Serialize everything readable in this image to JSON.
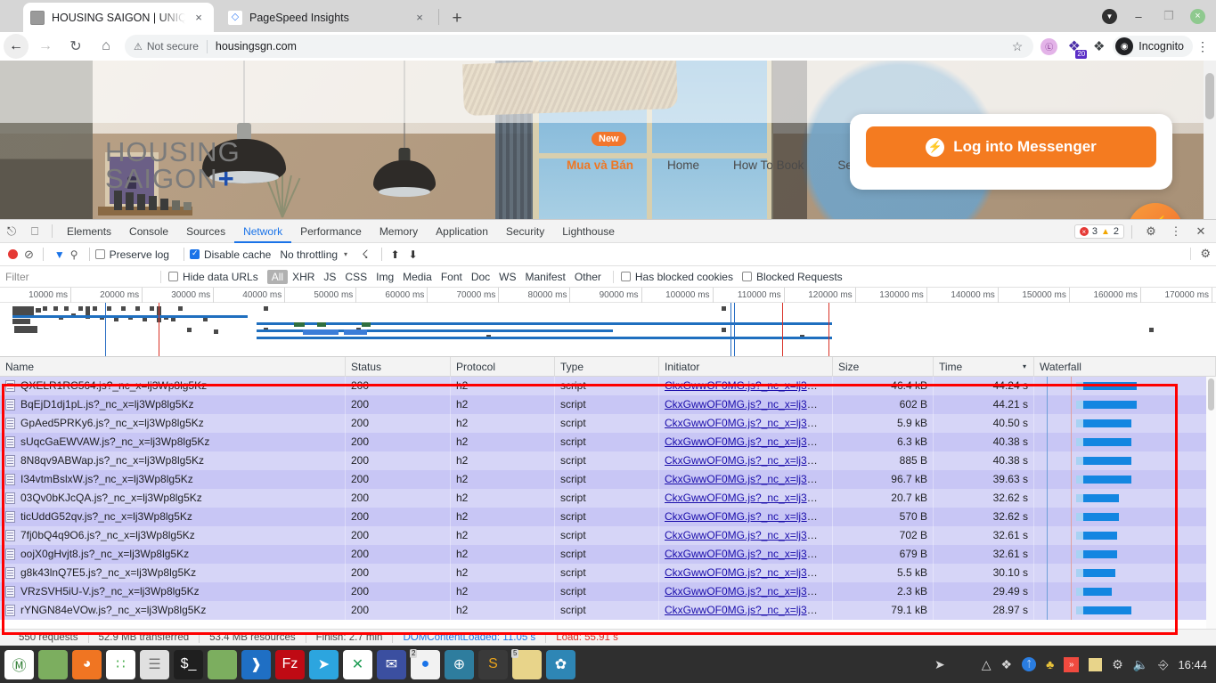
{
  "browser": {
    "tabs": [
      {
        "title": "HOUSING SAIGON | UNIQUE A",
        "favicon": "site-thumbnail-icon",
        "active": true,
        "close_label": "×"
      },
      {
        "title": "PageSpeed Insights",
        "favicon": "pagespeed-icon",
        "active": false,
        "close_label": "×"
      }
    ],
    "new_tab_label": "+",
    "window_controls": {
      "restore": "▼",
      "minimize": "–",
      "maximize": "❐",
      "close": "×"
    },
    "nav": {
      "back": "←",
      "forward": "→",
      "reload": "↻",
      "home": "⌂"
    },
    "omnibox": {
      "security_label": "Not secure",
      "security_icon": "warning-triangle-icon",
      "url": "housingsgn.com",
      "bookmark_star": "☆"
    },
    "extensions": [
      {
        "name": "lastpass-extension-icon",
        "glyph": "Ⓛ"
      },
      {
        "name": "bookmark-manager-extension-icon",
        "glyph": "❖",
        "badge": "20"
      },
      {
        "name": "extensions-puzzle-icon",
        "glyph": "❖"
      }
    ],
    "profile": {
      "label": "Incognito",
      "icon": "incognito-hat-icon"
    },
    "menu_label": "⋮"
  },
  "webpage": {
    "logo_line1": "HOUSING",
    "logo_line2": "SAIGON",
    "logo_plus": "+",
    "new_badge": "New",
    "nav_items": [
      "Mua và Bán",
      "Home",
      "How To Book",
      "Search b"
    ],
    "messenger_card": {
      "button_label": "Log into Messenger",
      "button_icon": "messenger-glyph-icon",
      "color": "#f47b20"
    },
    "fab_icon": "messenger-fab-icon"
  },
  "devtools": {
    "tabs": [
      "Elements",
      "Console",
      "Sources",
      "Network",
      "Performance",
      "Memory",
      "Application",
      "Security",
      "Lighthouse"
    ],
    "active_tab": "Network",
    "inspect_icon": "inspect-element-icon",
    "device_icon": "toggle-device-toolbar-icon",
    "issues": {
      "errors": "3",
      "warnings": "2"
    },
    "settings_icon": "gear-icon",
    "more_icon": "kebab-menu-icon",
    "close_icon": "close-icon",
    "toolbar": {
      "record_icon": "record-stop-icon",
      "clear_icon": "clear-network-log-icon",
      "filter_icon": "filter-funnel-icon",
      "search_icon": "search-icon",
      "preserve_log_label": "Preserve log",
      "preserve_log_checked": false,
      "disable_cache_label": "Disable cache",
      "disable_cache_checked": true,
      "throttling_value": "No throttling",
      "throttling_caret": "▾",
      "network_conditions_icon": "wifi-settings-icon",
      "import_icon": "import-har-icon",
      "export_icon": "export-har-icon",
      "settings_icon": "gear-icon"
    },
    "filterbar": {
      "filter_placeholder": "Filter",
      "filter_value": "",
      "hide_data_urls_label": "Hide data URLs",
      "hide_data_urls_checked": false,
      "types": [
        "All",
        "XHR",
        "JS",
        "CSS",
        "Img",
        "Media",
        "Font",
        "Doc",
        "WS",
        "Manifest",
        "Other"
      ],
      "selected_type": "All",
      "has_blocked_cookies_label": "Has blocked cookies",
      "has_blocked_cookies_checked": false,
      "blocked_requests_label": "Blocked Requests",
      "blocked_requests_checked": false
    },
    "overview_ticks": [
      "10000 ms",
      "20000 ms",
      "30000 ms",
      "40000 ms",
      "50000 ms",
      "60000 ms",
      "70000 ms",
      "80000 ms",
      "90000 ms",
      "100000 ms",
      "110000 ms",
      "120000 ms",
      "130000 ms",
      "140000 ms",
      "150000 ms",
      "160000 ms",
      "170000 ms"
    ],
    "columns": [
      "Name",
      "Status",
      "Protocol",
      "Type",
      "Initiator",
      "Size",
      "Time",
      "Waterfall"
    ],
    "sorted_column": "Time",
    "sort_caret": "▾",
    "rows": [
      {
        "name": "QXELR1RC564.js?_nc_x=lj3Wp8lg5Kz",
        "status": "200",
        "protocol": "h2",
        "type": "script",
        "initiator": "CkxGwwOF0MG.js?_nc_x=lj3Wp...",
        "size": "46.4 kB",
        "time": "44.24 s"
      },
      {
        "name": "BqEjD1dj1pL.js?_nc_x=lj3Wp8lg5Kz",
        "status": "200",
        "protocol": "h2",
        "type": "script",
        "initiator": "CkxGwwOF0MG.js?_nc_x=lj3Wp...",
        "size": "602 B",
        "time": "44.21 s"
      },
      {
        "name": "GpAed5PRKy6.js?_nc_x=lj3Wp8lg5Kz",
        "status": "200",
        "protocol": "h2",
        "type": "script",
        "initiator": "CkxGwwOF0MG.js?_nc_x=lj3Wp...",
        "size": "5.9 kB",
        "time": "40.50 s"
      },
      {
        "name": "sUqcGaEWVAW.js?_nc_x=lj3Wp8lg5Kz",
        "status": "200",
        "protocol": "h2",
        "type": "script",
        "initiator": "CkxGwwOF0MG.js?_nc_x=lj3Wp...",
        "size": "6.3 kB",
        "time": "40.38 s"
      },
      {
        "name": "8N8qv9ABWap.js?_nc_x=lj3Wp8lg5Kz",
        "status": "200",
        "protocol": "h2",
        "type": "script",
        "initiator": "CkxGwwOF0MG.js?_nc_x=lj3Wp...",
        "size": "885 B",
        "time": "40.38 s"
      },
      {
        "name": "I34vtmBslxW.js?_nc_x=lj3Wp8lg5Kz",
        "status": "200",
        "protocol": "h2",
        "type": "script",
        "initiator": "CkxGwwOF0MG.js?_nc_x=lj3Wp...",
        "size": "96.7 kB",
        "time": "39.63 s"
      },
      {
        "name": "03Qv0bKJcQA.js?_nc_x=lj3Wp8lg5Kz",
        "status": "200",
        "protocol": "h2",
        "type": "script",
        "initiator": "CkxGwwOF0MG.js?_nc_x=lj3Wp...",
        "size": "20.7 kB",
        "time": "32.62 s"
      },
      {
        "name": "ticUddG52qv.js?_nc_x=lj3Wp8lg5Kz",
        "status": "200",
        "protocol": "h2",
        "type": "script",
        "initiator": "CkxGwwOF0MG.js?_nc_x=lj3Wp...",
        "size": "570 B",
        "time": "32.62 s"
      },
      {
        "name": "7fj0bQ4q9O6.js?_nc_x=lj3Wp8lg5Kz",
        "status": "200",
        "protocol": "h2",
        "type": "script",
        "initiator": "CkxGwwOF0MG.js?_nc_x=lj3Wp...",
        "size": "702 B",
        "time": "32.61 s"
      },
      {
        "name": "oojX0gHvjt8.js?_nc_x=lj3Wp8lg5Kz",
        "status": "200",
        "protocol": "h2",
        "type": "script",
        "initiator": "CkxGwwOF0MG.js?_nc_x=lj3Wp...",
        "size": "679 B",
        "time": "32.61 s"
      },
      {
        "name": "g8k43lnQ7E5.js?_nc_x=lj3Wp8lg5Kz",
        "status": "200",
        "protocol": "h2",
        "type": "script",
        "initiator": "CkxGwwOF0MG.js?_nc_x=lj3Wp...",
        "size": "5.5 kB",
        "time": "30.10 s"
      },
      {
        "name": "VRzSVH5iU-V.js?_nc_x=lj3Wp8lg5Kz",
        "status": "200",
        "protocol": "h2",
        "type": "script",
        "initiator": "CkxGwwOF0MG.js?_nc_x=lj3Wp...",
        "size": "2.3 kB",
        "time": "29.49 s"
      },
      {
        "name": "rYNGN84eVOw.js?_nc_x=lj3Wp8lg5Kz",
        "status": "200",
        "protocol": "h2",
        "type": "script",
        "initiator": "CkxGwwOF0MG.js?_nc_x=lj3Wp...",
        "size": "79.1 kB",
        "time": "28.97 s"
      }
    ],
    "status_bar": {
      "requests": "550 requests",
      "transferred": "52.9 MB transferred",
      "resources": "53.4 MB resources",
      "finish": "Finish: 2.7 min",
      "dom_content_loaded": "DOMContentLoaded: 11.05 s",
      "load": "Load: 55.91 s"
    }
  },
  "taskbar": {
    "apps": [
      {
        "name": "linux-mint-menu-icon",
        "glyph": "Ⓜ",
        "bg": "#ffffff",
        "fg": "#2e7d32"
      },
      {
        "name": "files-green-icon",
        "glyph": "",
        "bg": "#7cae5f",
        "fg": "#ffffff"
      },
      {
        "name": "firefox-icon",
        "glyph": "◕",
        "bg": "#f07522",
        "fg": "#ffffff"
      },
      {
        "name": "app-grid-icon",
        "glyph": "∷",
        "bg": "#ffffff",
        "fg": "#4caf50"
      },
      {
        "name": "settings-toggles-icon",
        "glyph": "☰",
        "bg": "#e0e0e0",
        "fg": "#777777"
      },
      {
        "name": "terminal-icon",
        "glyph": "$_",
        "bg": "#1f1f1f",
        "fg": "#ffffff"
      },
      {
        "name": "file-manager-icon",
        "glyph": "",
        "bg": "#7cae5f",
        "fg": "#ffffff"
      },
      {
        "name": "vscode-icon",
        "glyph": "❱",
        "bg": "#1f6fc4",
        "fg": "#ffffff"
      },
      {
        "name": "filezilla-icon",
        "glyph": "Fz",
        "bg": "#bf0a14",
        "fg": "#ffffff"
      },
      {
        "name": "telegram-icon",
        "glyph": "➤",
        "bg": "#2ca5df",
        "fg": "#ffffff"
      },
      {
        "name": "xshell-icon",
        "glyph": "✕",
        "bg": "#ffffff",
        "fg": "#1f9d55"
      },
      {
        "name": "mail-icon",
        "glyph": "✉",
        "bg": "#3b4fa0",
        "fg": "#ffffff"
      },
      {
        "name": "chrome-icon",
        "glyph": "●",
        "bg": "#f2f2f2",
        "fg": "#1a73e8",
        "badge": "2"
      },
      {
        "name": "globe-network-icon",
        "glyph": "⊕",
        "bg": "#2e7d9e",
        "fg": "#ffffff"
      },
      {
        "name": "sublime-text-icon",
        "glyph": "S",
        "bg": "#3a3a3a",
        "fg": "#e8a21c"
      },
      {
        "name": "sticky-notes-icon",
        "glyph": "",
        "bg": "#e8d48a",
        "fg": "#7a6a2a",
        "badge": "5"
      },
      {
        "name": "gimp-icon",
        "glyph": "✿",
        "bg": "#2e86b5",
        "fg": "#ffffff"
      }
    ],
    "tray": [
      {
        "name": "telegram-tray-icon",
        "glyph": "➤"
      },
      {
        "name": "shield-security-icon",
        "glyph": "⛊"
      },
      {
        "name": "dropbox-icon",
        "glyph": "❖"
      },
      {
        "name": "bluetooth-icon",
        "glyph": "Ƀ"
      },
      {
        "name": "colors-tray-icon",
        "glyph": "♣"
      },
      {
        "name": "insync-icon",
        "glyph": "»"
      },
      {
        "name": "notes-tray-icon",
        "glyph": "⬜"
      },
      {
        "name": "printer-icon",
        "glyph": "⎙"
      },
      {
        "name": "volume-muted-icon",
        "glyph": "🔈"
      },
      {
        "name": "clipboard-icon",
        "glyph": "⎘"
      }
    ],
    "clock": "16:44"
  }
}
